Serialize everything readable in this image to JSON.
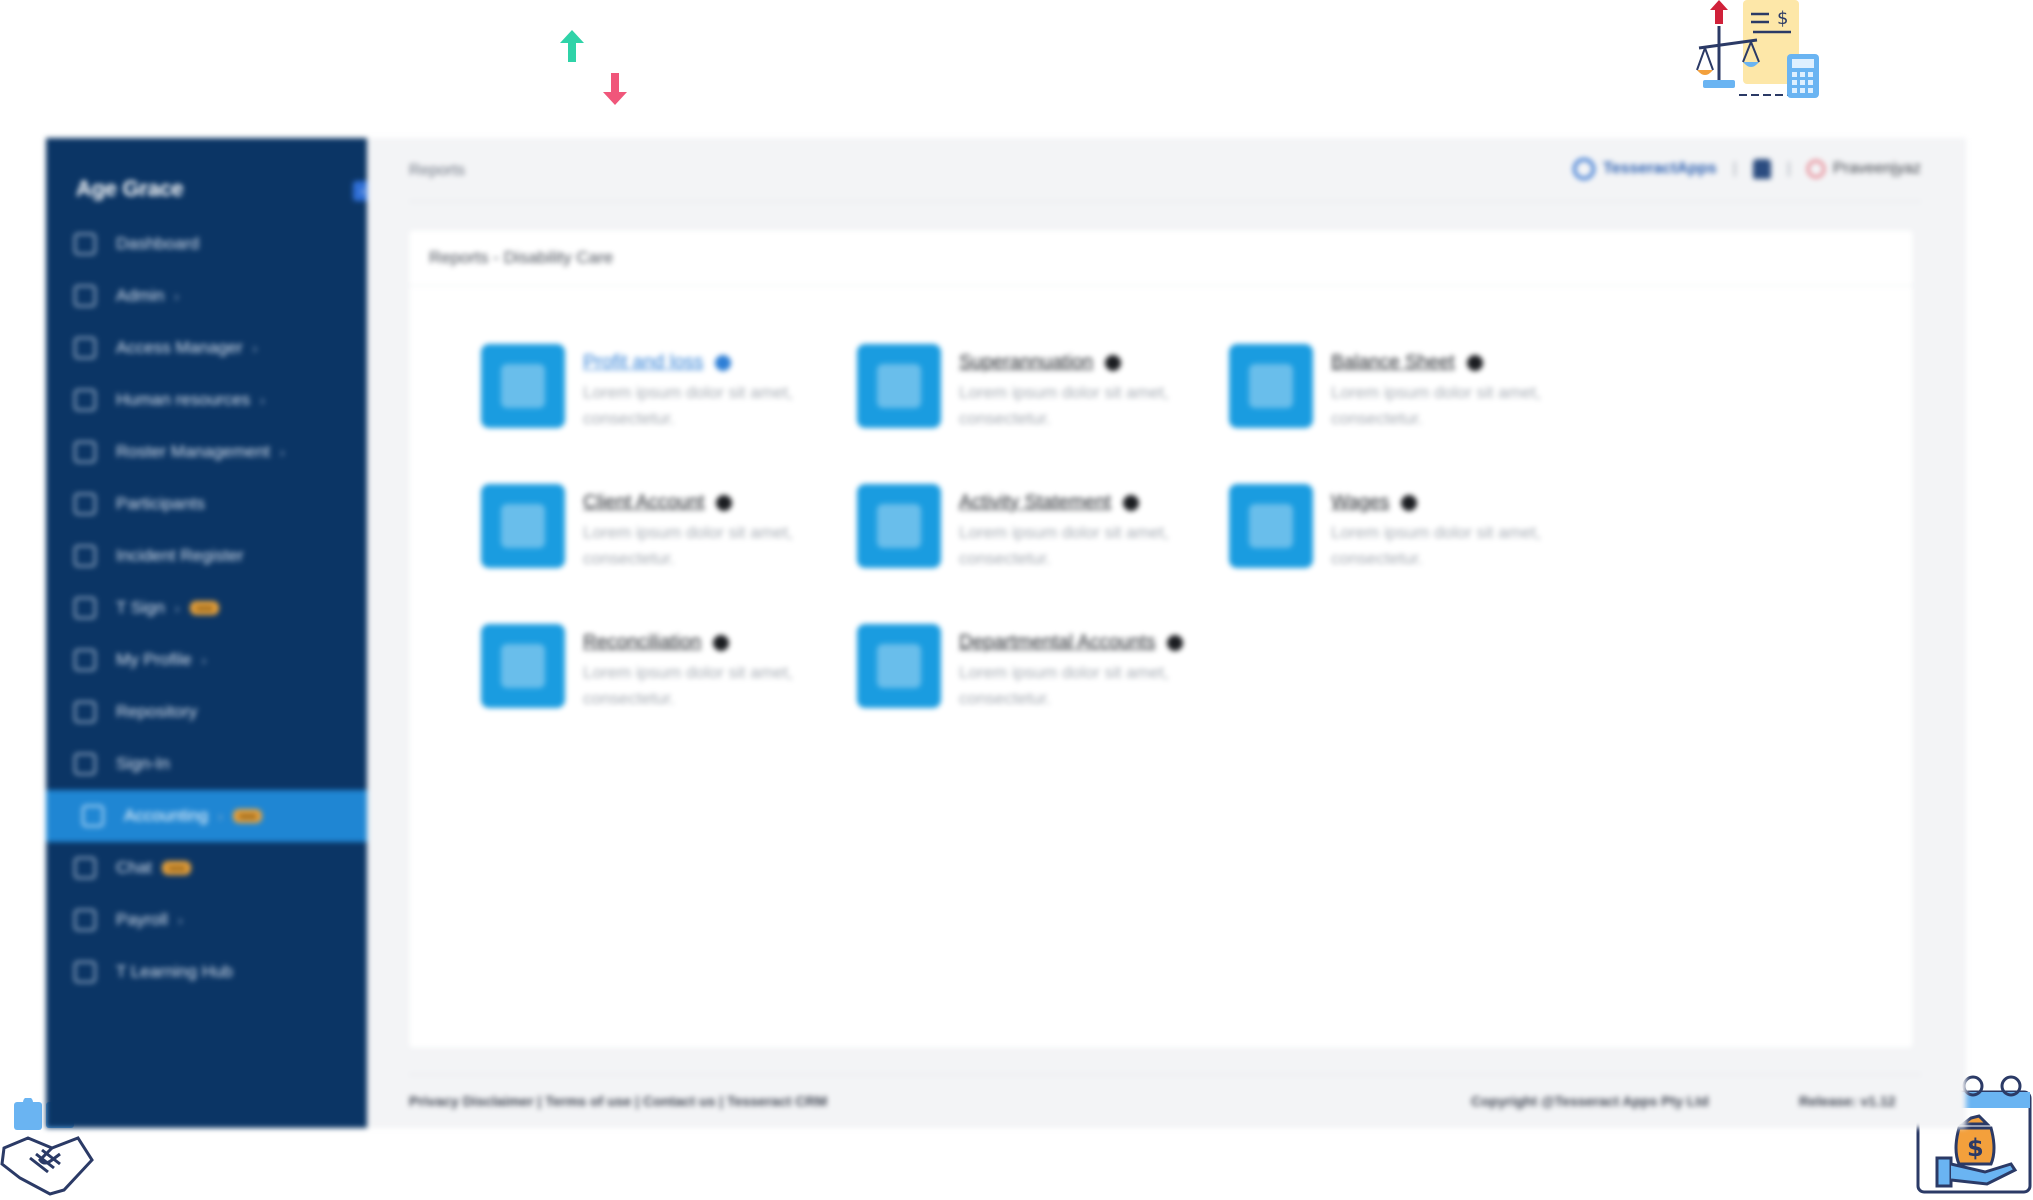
{
  "app": {
    "brand": "Age Grace",
    "collapse_icon": "collapse-icon"
  },
  "sidebar": {
    "items": [
      {
        "label": "Dashboard",
        "icon": "grid-icon",
        "chevron": false,
        "badge": ""
      },
      {
        "label": "Admin",
        "icon": "shield-icon",
        "chevron": true,
        "badge": ""
      },
      {
        "label": "Access Manager",
        "icon": "shield-check-icon",
        "chevron": true,
        "badge": ""
      },
      {
        "label": "Human resources",
        "icon": "folder-icon",
        "chevron": true,
        "badge": ""
      },
      {
        "label": "Roster Management",
        "icon": "calendar-icon",
        "chevron": true,
        "badge": ""
      },
      {
        "label": "Participants",
        "icon": "users-icon",
        "chevron": false,
        "badge": ""
      },
      {
        "label": "Incident Register",
        "icon": "alert-icon",
        "chevron": false,
        "badge": ""
      },
      {
        "label": "T Sign",
        "icon": "signature-icon",
        "chevron": true,
        "badge": "new"
      },
      {
        "label": "My Profile",
        "icon": "user-icon",
        "chevron": true,
        "badge": ""
      },
      {
        "label": "Repository",
        "icon": "archive-icon",
        "chevron": false,
        "badge": ""
      },
      {
        "label": "Sign-In",
        "icon": "key-icon",
        "chevron": false,
        "badge": ""
      },
      {
        "label": "Accounting",
        "icon": "ledger-icon",
        "chevron": true,
        "badge": "new",
        "active": true
      },
      {
        "label": "Chat",
        "icon": "chat-icon",
        "chevron": false,
        "badge": "new"
      },
      {
        "label": "Payroll",
        "icon": "wallet-icon",
        "chevron": true,
        "badge": ""
      },
      {
        "label": "T Learning Hub",
        "icon": "book-icon",
        "chevron": false,
        "badge": ""
      }
    ]
  },
  "topbar": {
    "breadcrumb": "Reports",
    "org": "TesseractApps",
    "separator": "|",
    "user": "Praveenjyaz"
  },
  "card": {
    "title": "Reports - Disability Care"
  },
  "reports": [
    {
      "title": "Profit and loss",
      "desc": "Lorem ipsum dolor sit amet, consectetur.",
      "icon": "thermometer-chart-icon",
      "link": true
    },
    {
      "title": "Superannuation",
      "desc": "Lorem ipsum dolor sit amet, consectetur.",
      "icon": "piggy-bank-icon",
      "link": false
    },
    {
      "title": "Balance Sheet",
      "desc": "Lorem ipsum dolor sit amet, consectetur.",
      "icon": "balance-sheet-icon",
      "link": false
    },
    {
      "title": "Client Account",
      "desc": "Lorem ipsum dolor sit amet, consectetur.",
      "icon": "client-card-icon",
      "link": false
    },
    {
      "title": "Activity Statement",
      "desc": "Lorem ipsum dolor sit amet, consectetur.",
      "icon": "statement-icon",
      "link": false
    },
    {
      "title": "Wages",
      "desc": "Lorem ipsum dolor sit amet, consectetur.",
      "icon": "wages-icon",
      "link": false
    },
    {
      "title": "Reconciliation",
      "desc": "Lorem ipsum dolor sit amet, consectetur.",
      "icon": "reconcile-icon",
      "link": false
    },
    {
      "title": "Departmental Accounts",
      "desc": "Lorem ipsum dolor sit amet, consectetur.",
      "icon": "department-chart-icon",
      "link": false
    }
  ],
  "footer": {
    "links": "Privacy Disclaimer | Terms of use | Contact us | Tesseract CRM",
    "copyright": "Copyright @Tesseract Apps Pty Ltd",
    "release": "Release: v1.12"
  },
  "colors": {
    "sidebar_bg": "#0b3565",
    "active_item": "#1f86d3",
    "tile_icon": "#1a9ce0",
    "badge": "#e9a23b",
    "link": "#2e7fd6"
  }
}
